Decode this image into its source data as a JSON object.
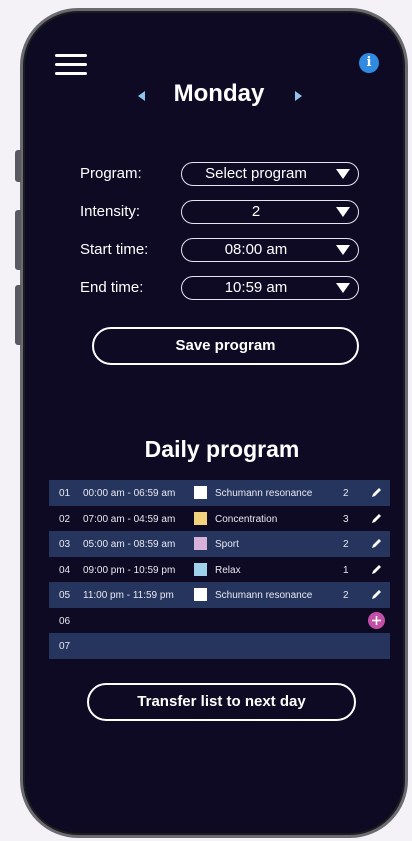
{
  "header": {
    "menu_icon": "hamburger-icon",
    "info_icon": "info-icon",
    "info_label": "i",
    "day": "Monday",
    "prev_icon": "triangle-left-icon",
    "next_icon": "triangle-right-icon"
  },
  "form": {
    "program_label": "Program:",
    "program_value": "Select program",
    "intensity_label": "Intensity:",
    "intensity_value": "2",
    "start_label": "Start time:",
    "start_value": "08:00 am",
    "end_label": "End time:",
    "end_value": "10:59 am",
    "save_label": "Save program"
  },
  "daily": {
    "title": "Daily program",
    "rows": [
      {
        "no": "01",
        "time": "00:00 am - 06:59 am",
        "color": "#ffffff",
        "program": "Schumann resonance",
        "intensity": "2"
      },
      {
        "no": "02",
        "time": "07:00 am - 04:59 am",
        "color": "#f2d27a",
        "program": "Concentration",
        "intensity": "3"
      },
      {
        "no": "03",
        "time": "05:00 am - 08:59 am",
        "color": "#d7b1d8",
        "program": "Sport",
        "intensity": "2"
      },
      {
        "no": "04",
        "time": "09:00 pm - 10:59 pm",
        "color": "#9fd2ea",
        "program": "Relax",
        "intensity": "1"
      },
      {
        "no": "05",
        "time": "11:00 pm - 11:59 pm",
        "color": "#ffffff",
        "program": "Schumann resonance",
        "intensity": "2"
      },
      {
        "no": "06",
        "time": "",
        "color": "",
        "program": "",
        "intensity": ""
      },
      {
        "no": "07",
        "time": "",
        "color": "",
        "program": "",
        "intensity": ""
      }
    ],
    "add_icon": "plus-circle-icon",
    "add_label": "+"
  },
  "transfer_label": "Transfer list to next day",
  "colors": {
    "background": "#0f0a24",
    "row_highlight": "#26355e",
    "accent_pink": "#c44fa6",
    "info_blue": "#2f8ae0",
    "arrow_blue": "#8ec5ee"
  }
}
